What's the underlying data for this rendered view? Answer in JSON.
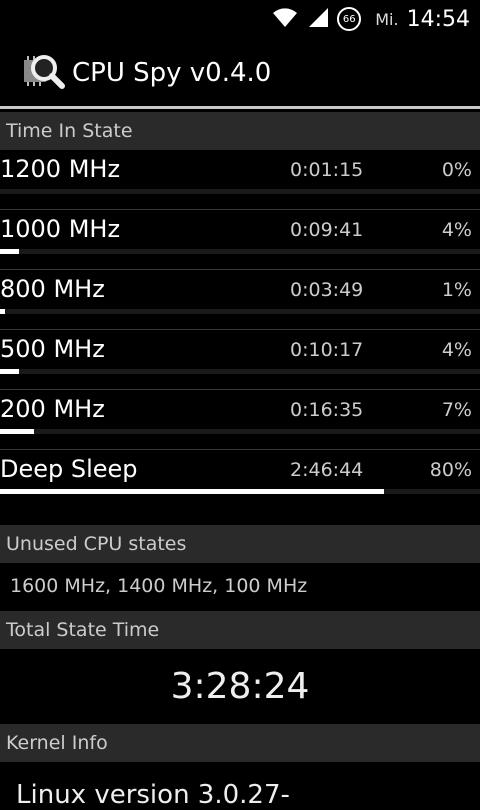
{
  "status_bar": {
    "battery_level": "66",
    "carrier": "Mi.",
    "time": "14:54"
  },
  "app_bar": {
    "title": "CPU Spy v0.4.0",
    "icon": "magnifier-chip-icon"
  },
  "time_in_state": {
    "header": "Time In State",
    "rows": [
      {
        "freq": "1200 MHz",
        "time": "0:01:15",
        "percent": "0%",
        "fraction": 0.0
      },
      {
        "freq": "1000 MHz",
        "time": "0:09:41",
        "percent": "4%",
        "fraction": 0.04
      },
      {
        "freq": "800 MHz",
        "time": "0:03:49",
        "percent": "1%",
        "fraction": 0.01
      },
      {
        "freq": "500 MHz",
        "time": "0:10:17",
        "percent": "4%",
        "fraction": 0.04
      },
      {
        "freq": "200 MHz",
        "time": "0:16:35",
        "percent": "7%",
        "fraction": 0.07
      },
      {
        "freq": "Deep Sleep",
        "time": "2:46:44",
        "percent": "80%",
        "fraction": 0.8
      }
    ]
  },
  "unused_states": {
    "header": "Unused CPU states",
    "text": "1600 MHz, 1400 MHz, 100 MHz"
  },
  "total_state_time": {
    "header": "Total State Time",
    "value": "3:28:24"
  },
  "kernel_info": {
    "header": "Kernel Info",
    "text": "Linux version 3.0.27-"
  }
}
